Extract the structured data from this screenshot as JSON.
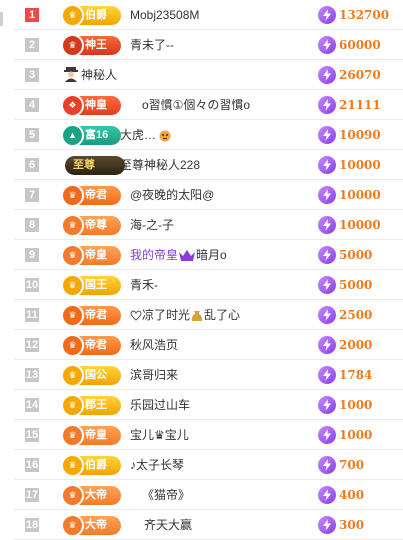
{
  "colors": {
    "rank_top": "#ef4a4a",
    "rank_default": "#c7c7c7",
    "score": "#f07a1c",
    "score_icon": "#9c4bf0",
    "purple_name": "#8b3dd6"
  },
  "leaderboard": [
    {
      "rank": "1",
      "badge": "伯爵",
      "badge_style": "gold",
      "name": "Mobj23508M",
      "score": "132700"
    },
    {
      "rank": "2",
      "badge": "神王",
      "badge_style": "red",
      "name": "青未了--",
      "score": "60000"
    },
    {
      "rank": "3",
      "badge": "",
      "badge_style": "mystery",
      "name": "神秘人",
      "score": "26070"
    },
    {
      "rank": "4",
      "badge": "神皇",
      "badge_style": "red",
      "name": "o習慣①個々の習慣o",
      "score": "21111"
    },
    {
      "rank": "5",
      "badge": "富16",
      "badge_style": "teal",
      "name": "大虎…",
      "score": "10090"
    },
    {
      "rank": "6",
      "badge": "至尊",
      "badge_style": "dark",
      "name": "至尊神秘人228",
      "score": "10000"
    },
    {
      "rank": "7",
      "badge": "帝君",
      "badge_style": "orange",
      "name": "@夜晚的太阳@",
      "score": "10000"
    },
    {
      "rank": "8",
      "badge": "帝尊",
      "badge_style": "orange",
      "name": "海-之-子",
      "score": "10000"
    },
    {
      "rank": "9",
      "badge": "帝皇",
      "badge_style": "orange",
      "name": "我的帝皇",
      "name_extra": "暗月o",
      "score": "5000"
    },
    {
      "rank": "10",
      "badge": "国王",
      "badge_style": "gold",
      "name": "青禾-",
      "score": "5000"
    },
    {
      "rank": "11",
      "badge": "帝君",
      "badge_style": "orange",
      "name": "凉了时光",
      "name_extra": "乱了心",
      "score": "2500"
    },
    {
      "rank": "12",
      "badge": "帝君",
      "badge_style": "orange",
      "name": "秋风浩页",
      "score": "2000"
    },
    {
      "rank": "13",
      "badge": "国公",
      "badge_style": "gold",
      "name": "滨哥归来",
      "score": "1784"
    },
    {
      "rank": "14",
      "badge": "郡王",
      "badge_style": "gold",
      "name": "乐园过山车",
      "score": "1000"
    },
    {
      "rank": "15",
      "badge": "帝皇",
      "badge_style": "orange",
      "name": "宝儿♛宝儿",
      "score": "1000"
    },
    {
      "rank": "16",
      "badge": "伯爵",
      "badge_style": "gold",
      "name": "♪太子长琴",
      "score": "700"
    },
    {
      "rank": "17",
      "badge": "大帝",
      "badge_style": "orange",
      "name": "《猫帝》",
      "score": "400"
    },
    {
      "rank": "18",
      "badge": "大帝",
      "badge_style": "orange",
      "name": "齐天大赢",
      "score": "300"
    }
  ]
}
